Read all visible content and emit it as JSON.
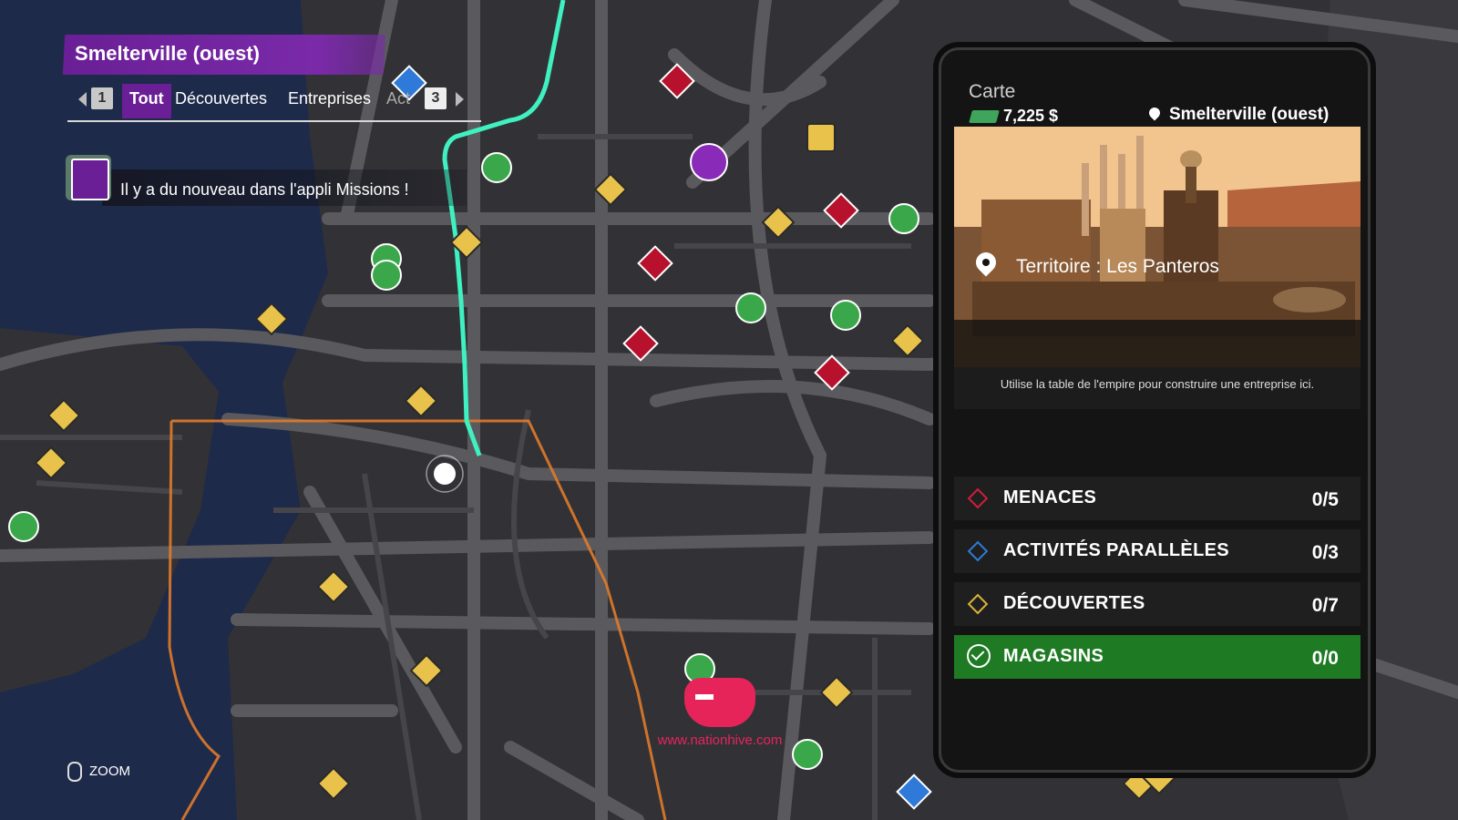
{
  "region_title": "Smelterville (ouest)",
  "filter": {
    "left_key": "1",
    "right_key": "3",
    "tabs": [
      {
        "label": "Tout",
        "active": true
      },
      {
        "label": "Découvertes",
        "active": false
      },
      {
        "label": "Entreprises",
        "active": false
      },
      {
        "label": "Act",
        "active": false
      }
    ]
  },
  "notification": {
    "icon": "missions-app-icon",
    "text": "Il y a du nouveau dans l'appli Missions !"
  },
  "zoom": {
    "icon": "mouse-icon",
    "label": "ZOOM"
  },
  "panel": {
    "header_label": "Carte",
    "money": "7,225 $",
    "location": "Smelterville (ouest)",
    "territory": "Territoire : Les Panteros",
    "description": "Utilise la table de l'empire pour construire une entreprise ici.",
    "rows": [
      {
        "label": "MENACES",
        "value": "0/5",
        "color": "#d01e3a"
      },
      {
        "label": "ACTIVITÉS PARALLÈLES",
        "value": "0/3",
        "color": "#2f7ad8"
      },
      {
        "label": "DÉCOUVERTES",
        "value": "0/7",
        "color": "#d8b43a"
      },
      {
        "label": "MAGASINS",
        "value": "0/0",
        "color": "#1e7a23",
        "selected": true
      }
    ]
  },
  "watermark": "www.nationhive.com",
  "colors": {
    "accent_purple": "#6a1f96",
    "route_teal": "#3ff0c0",
    "territory_orange": "#e07a2a",
    "road_gray": "#5a5a5e",
    "water": "#1e2a4a"
  }
}
